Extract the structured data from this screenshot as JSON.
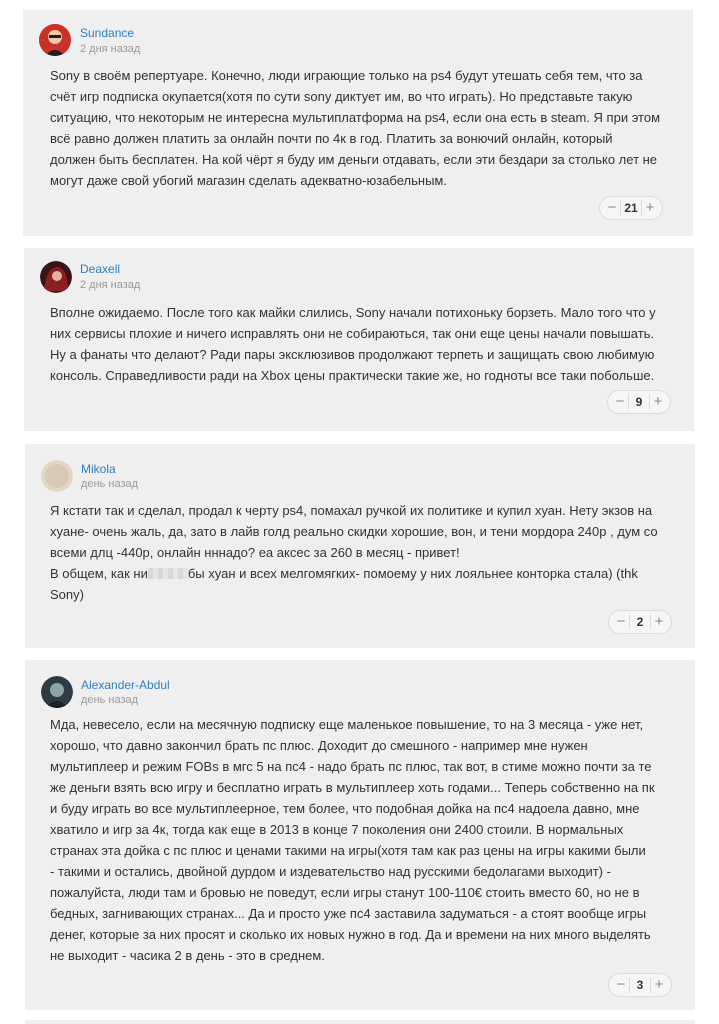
{
  "comments": [
    {
      "author": "Sundance",
      "time": "2 дня назад",
      "lines": [
        "Sony в своём репертуаре. Конечно, люди играющие только на ps4 будут утешать себя тем, что за",
        "счёт игр подписка окупается(хотя по сути sony диктует им, во что играть). Но представьте такую",
        "ситуацию, что некоторым не интересна мультиплатформа на ps4, если она есть в steam. Я при этом",
        "всё равно должен платить за онлайн почти по 4к в год. Платить за вонючий онлайн, который",
        "должен быть бесплатен. На кой чёрт я буду им деньги отдавать, если эти бездари за столько лет не",
        "могут даже свой убогий магазин сделать адекватно-юзабельным."
      ],
      "votes": "21",
      "avatar_color": "#c8322a"
    },
    {
      "author": "Deaxell",
      "time": "2 дня назад",
      "lines": [
        "Вполне ожидаемо. После того как майки слились, Sony начали потихоньку борзеть. Мало того что у",
        "них сервисы плохие и ничего исправлять они не собираються, так они еще цены начали повышать.",
        "Ну а фанаты что делают? Ради пары эксклюзивов продолжают терпеть и защищать свою любимую",
        "консоль. Справедливости ради на Xbox цены практически такие же, но годноты все таки побольше."
      ],
      "votes": "9",
      "avatar_color": "#7a1f22"
    },
    {
      "author": "Mikola",
      "time": "день назад",
      "lines": [
        "Я кстати так и сделал, продал к черту ps4, помахал ручкой их политике и купил хуан. Нету экзов на",
        "хуане- очень жаль, да, зато в лайв голд реально скидки хорошие, вон, и тени мордора 240р , дум со",
        "всеми длц -440р, онлайн нннадо? еа аксес за 260 в месяц - привет!"
      ],
      "line4_before": "В общем, как ни",
      "line4_after": "бы хуан и всех мелгомягких- помоему у них лояльнее конторка стала) (thk",
      "line5": "Sony)",
      "votes": "2",
      "avatar_color": "#e2d7c6"
    },
    {
      "author": "Alexander-Abdul",
      "time": "день назад",
      "lines": [
        "Мда, невесело, если на месячную подписку еще маленькое повышение, то на 3 месяца - уже нет,",
        "хорошо, что давно закончил брать пс плюс. Доходит до смешного - например мне нужен",
        "мультиплеер и режим FOBs в мгс 5 на пс4 - надо брать пс плюс, так вот, в стиме можно почти за те",
        "же деньги взять всю игру и бесплатно играть в мультиплеер хоть годами... Теперь собственно на пк",
        "и буду играть во все мультиплеерное, тем более, что подобная дойка на пс4 надоела давно, мне",
        "хватило и игр за 4к, тогда как еще в 2013 в конце 7 поколения они 2400 стоили. В нормальных",
        "странах эта дойка с пс плюс и ценами такими на игры(хотя там как раз цены на игры какими были",
        "- такими и остались, двойной дурдом и издевательство над русскими бедолагами выходит) -",
        "пожалуйста, люди там и бровью не поведут, если игры станут 100-110€ стоить вместо 60, но не в",
        "бедных, загнивающих странах... Да и просто уже пс4 заставила задуматься - а стоят вообще игры",
        "денег, которые за них просят и сколько их новых нужно в год. Да и времени на них много выделять",
        "не выходит - часика 2 в день - это в среднем."
      ],
      "votes": "3",
      "avatar_color": "#2e3b44"
    }
  ],
  "vote_icons": {
    "minus": "minus-icon",
    "plus": "plus-icon"
  }
}
